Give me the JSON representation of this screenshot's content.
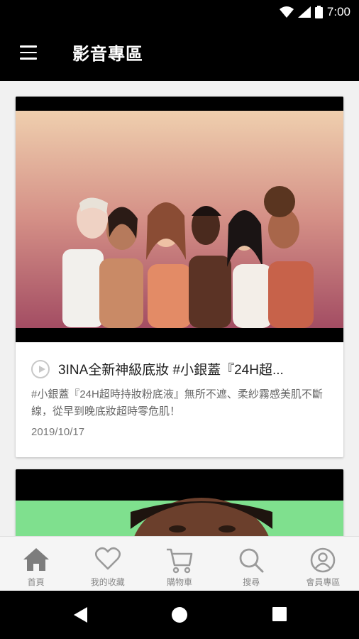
{
  "status_bar": {
    "time": "7:00",
    "icons": [
      "wifi-icon",
      "signal-icon",
      "battery-icon"
    ]
  },
  "app_bar": {
    "title": "影音專區",
    "menu_icon": "hamburger-menu-icon"
  },
  "videos": [
    {
      "title": "3INA全新神級底妝 #小銀蓋『24H超...",
      "description": "#小銀蓋『24H超時持妝粉底液』無所不遮、柔紗霧感美肌不斷線，從早到晚底妝超時零危肌！",
      "date": "2019/10/17",
      "icon": "play-circle-icon"
    }
  ],
  "bottom_nav": {
    "items": [
      {
        "label": "首頁",
        "icon": "home-icon",
        "active": true
      },
      {
        "label": "我的收藏",
        "icon": "heart-icon"
      },
      {
        "label": "購物車",
        "icon": "cart-icon"
      },
      {
        "label": "搜尋",
        "icon": "search-icon"
      },
      {
        "label": "會員專區",
        "icon": "user-icon"
      }
    ]
  },
  "system_nav": {
    "icons": [
      "back-icon",
      "home-circle-icon",
      "recents-icon"
    ]
  },
  "colors": {
    "bar": "#000000",
    "background": "#f1f1f1",
    "nav_icon": "#9a9a9a",
    "active_nav_icon": "#7d7d7d"
  }
}
